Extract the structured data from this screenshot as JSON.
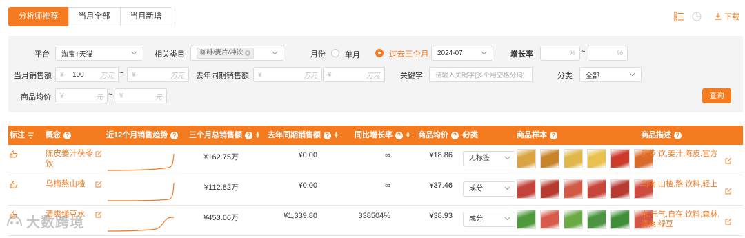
{
  "tabs": [
    "分析师推荐",
    "当月全部",
    "当月新增"
  ],
  "header": {
    "download_label": "下载"
  },
  "filters": {
    "platform_label": "平台",
    "platform_value": "淘宝+天猫",
    "category_label": "相关类目",
    "category_tag": "咖啡/麦片/冲饮",
    "month_label": "月份",
    "month_single": "单月",
    "month_past3": "过去三个月",
    "month_value": "2024-07",
    "growth_label": "增长率",
    "growth_unit": "%",
    "sales_label": "当月销售额",
    "currency": "¥",
    "sales_min": "100",
    "unit_wan": "万元",
    "prev_sales_label": "去年同期销售额",
    "keyword_label": "关键字",
    "keyword_placeholder": "请输入关键字(多个用空格分隔)",
    "class_label": "分类",
    "class_value": "全部",
    "price_label": "商品均价",
    "unit_yuan": "元",
    "tilde": "~",
    "query_button": "查询"
  },
  "table": {
    "headers": {
      "tag": "标注",
      "concept": "概念",
      "trend": "近12个月销售趋势",
      "total_sales": "三个月总销售额",
      "prev_sales": "去年同期销售额",
      "growth": "同比增长率",
      "avg_price": "商品均价",
      "category": "分类",
      "samples": "商品样本",
      "description": "商品描述"
    },
    "rows": [
      {
        "concept": "陈皮姜汁茯苓饮",
        "total_sales": "¥162.75万",
        "prev_sales": "¥0.00",
        "growth": "∞",
        "avg_price": "¥18.86",
        "category": "无标签",
        "description": "茯苓,饮,姜汁,陈皮,官方",
        "thumb_colors": [
          "#d9a441",
          "#c8842a",
          "#e0b84a",
          "#e9c24d",
          "#cc3a2a",
          "#d96b2a"
        ]
      },
      {
        "concept": "乌梅熬山楂",
        "total_sales": "¥112.82万",
        "prev_sales": "¥0.00",
        "growth": "∞",
        "avg_price": "¥37.46",
        "category": "成分",
        "description": "乌梅,山楂,熬,饮料,轻上",
        "thumb_colors": [
          "#c4443b",
          "#b8392e",
          "#d05a45",
          "#c9463a",
          "#b73a33",
          "#cf4b40"
        ]
      },
      {
        "concept": "清爽绿豆水",
        "total_sales": "¥453.66万",
        "prev_sales": "¥1,339.80",
        "growth": "338504%",
        "avg_price": "¥38.93",
        "category": "成分",
        "description": "水,元气,自在,饮料,森林,清爽,绿豆",
        "thumb_colors": [
          "#4f9a3c",
          "#d85a4a",
          "#6aaa45",
          "#4b9440",
          "#3f8f38",
          "#d35545"
        ]
      }
    ]
  },
  "watermark": "大数跨境"
}
